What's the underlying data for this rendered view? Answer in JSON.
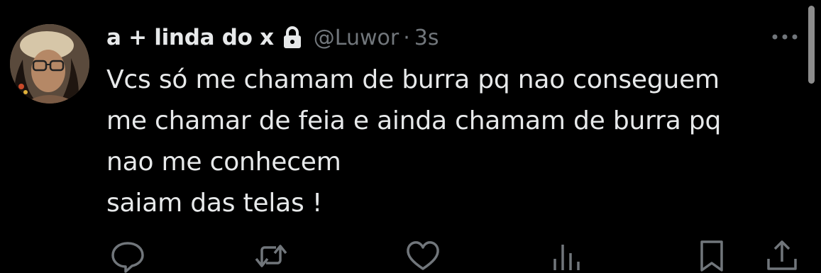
{
  "tweet": {
    "author": {
      "display_name": "a + linda do x",
      "handle": "@Luwor",
      "protected_icon": "lock-icon",
      "avatar_icon": "avatar"
    },
    "separator": "·",
    "timestamp": "3s",
    "text": "Vcs só me chamam de burra pq nao conseguem\nme chamar de feia e ainda chamam de burra pq\nnao me conhecem\nsaiam das telas !",
    "more_icon": "more-horizontal-icon"
  },
  "actions": [
    {
      "name": "reply",
      "icon": "reply-icon"
    },
    {
      "name": "retweet",
      "icon": "retweet-icon"
    },
    {
      "name": "like",
      "icon": "heart-icon"
    },
    {
      "name": "views",
      "icon": "views-icon"
    },
    {
      "name": "bookmark",
      "icon": "bookmark-icon"
    },
    {
      "name": "share",
      "icon": "share-icon"
    }
  ],
  "colors": {
    "background": "#000000",
    "primary_text": "#e7e9ea",
    "secondary_text": "#71767b",
    "scrollbar": "#8c8c8c"
  }
}
